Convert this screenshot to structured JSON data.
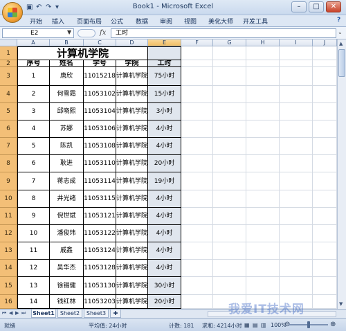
{
  "window": {
    "title": "Book1 - Microsoft Excel",
    "controls": {
      "minimize": "–",
      "maximize": "□",
      "close": "✕"
    }
  },
  "qat": {
    "save_icon": "save-icon",
    "undo_icon": "undo-icon",
    "redo_icon": "redo-icon",
    "customize_icon": "chevron-down-icon"
  },
  "ribbon": {
    "tabs": [
      "开始",
      "插入",
      "页面布局",
      "公式",
      "数据",
      "审阅",
      "视图",
      "美化大师",
      "开发工具"
    ],
    "help_icon": "help-icon"
  },
  "formula_bar": {
    "name_box": "E2",
    "fx": "fx",
    "content": "工时"
  },
  "columns": [
    "A",
    "B",
    "C",
    "D",
    "E",
    "F",
    "G",
    "H",
    "I",
    "J"
  ],
  "selected_column": "E",
  "rows": [
    "1",
    "2",
    "3",
    "4",
    "5",
    "6",
    "7",
    "8",
    "9",
    "10",
    "11",
    "12",
    "13",
    "14",
    "15",
    "16"
  ],
  "table": {
    "title": "计算机学院",
    "headers": [
      "序号",
      "姓名",
      "学号",
      "学院",
      "工时"
    ],
    "records": [
      [
        "1",
        "唐欣",
        "11015218",
        "计算机学院",
        "75小时"
      ],
      [
        "2",
        "何雪霜",
        "11053102",
        "计算机学院",
        "15小时"
      ],
      [
        "3",
        "邱晓熙",
        "11053104",
        "计算机学院",
        "3小时"
      ],
      [
        "4",
        "苏娜",
        "11053106",
        "计算机学院",
        "4小时"
      ],
      [
        "5",
        "陈凯",
        "11053108",
        "计算机学院",
        "4小时"
      ],
      [
        "6",
        "耿进",
        "11053110",
        "计算机学院",
        "20小时"
      ],
      [
        "7",
        "蒋志成",
        "11053114",
        "计算机学院",
        "19小时"
      ],
      [
        "8",
        "井光绪",
        "11053115",
        "计算机学院",
        "4小时"
      ],
      [
        "9",
        "倪世斌",
        "11053121",
        "计算机学院",
        "4小时"
      ],
      [
        "10",
        "潘俊玮",
        "11053122",
        "计算机学院",
        "4小时"
      ],
      [
        "11",
        "戚鑫",
        "11053124",
        "计算机学院",
        "4小时"
      ],
      [
        "12",
        "吴华杰",
        "11053128",
        "计算机学院",
        "4小时"
      ],
      [
        "13",
        "徐锡健",
        "11053130",
        "计算机学院",
        "30小时"
      ],
      [
        "14",
        "钱红林",
        "11053203",
        "计算机学院",
        "20小时"
      ]
    ]
  },
  "sheets": [
    "Sheet1",
    "Sheet2",
    "Sheet3"
  ],
  "active_sheet": "Sheet1",
  "status": {
    "mode": "就绪",
    "average": "平均值: 24小时",
    "count": "计数: 181",
    "sum": "求和: 4214小时",
    "zoom": "100%"
  },
  "watermark": "我爱IT技术网",
  "colors": {
    "row_header": "#f3bf77",
    "selected_column_header": "#f1bd63",
    "ribbon_bg": "#dde7f4",
    "grid_line": "#d4dae3"
  }
}
